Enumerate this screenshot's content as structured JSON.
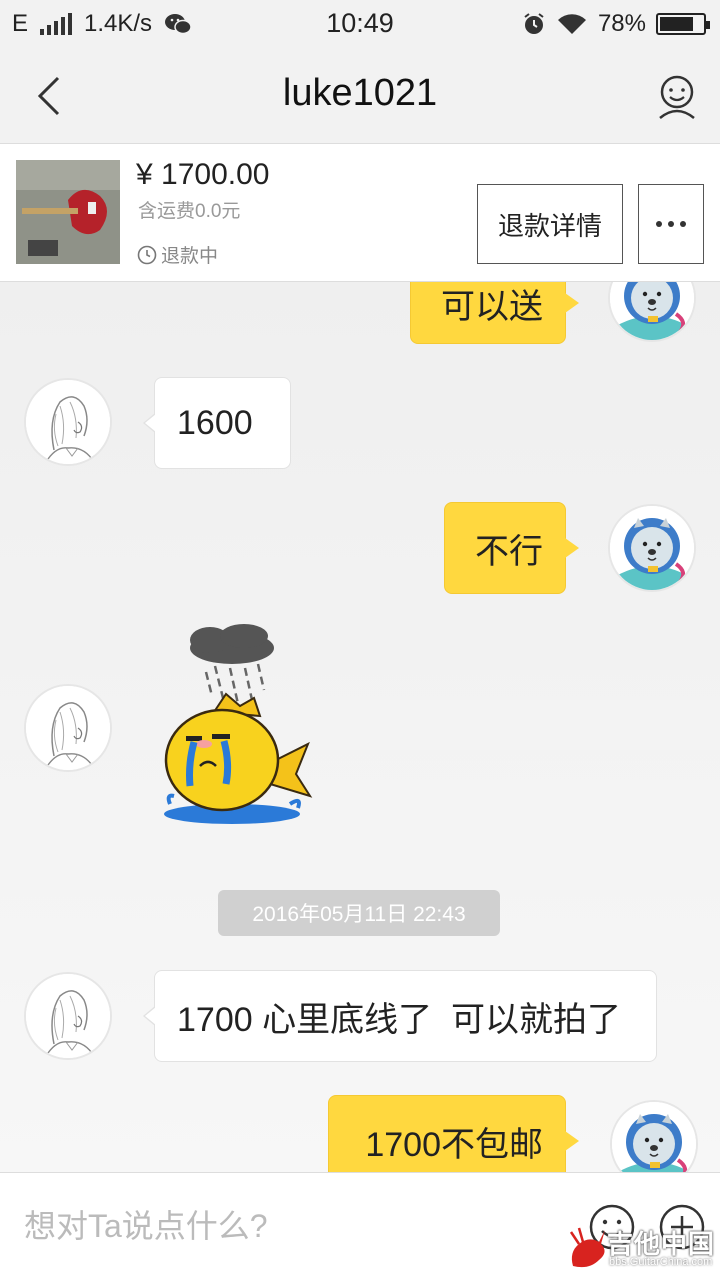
{
  "status_bar": {
    "network": "E",
    "speed": "1.4K/s",
    "time": "10:49",
    "battery": "78%",
    "battery_level": 0.78
  },
  "header": {
    "title": "luke1021"
  },
  "item": {
    "price": "¥ 1700.00",
    "shipping": "含运费0.0元",
    "status": "退款中",
    "refund_button": "退款详情"
  },
  "messages": [
    {
      "side": "out",
      "text": "可以送"
    },
    {
      "side": "in",
      "text": "1600"
    },
    {
      "side": "out",
      "text": "不行"
    },
    {
      "side": "in",
      "type": "sticker",
      "sticker": "crying-fish-sticker"
    },
    {
      "side": "in",
      "text": "1700 心里底线了  可以就拍了"
    },
    {
      "side": "out",
      "text": "1700不包邮"
    }
  ],
  "timestamp": "2016年05月11日 22:43",
  "input": {
    "placeholder": "想对Ta说点什么?"
  },
  "watermark": {
    "text": "吉他中国",
    "url": "bbs.GuitarChina.com"
  },
  "colors": {
    "outgoing_bubble": "#ffd83f",
    "incoming_bubble": "#ffffff",
    "timestamp_bg": "#d0d0d0"
  }
}
